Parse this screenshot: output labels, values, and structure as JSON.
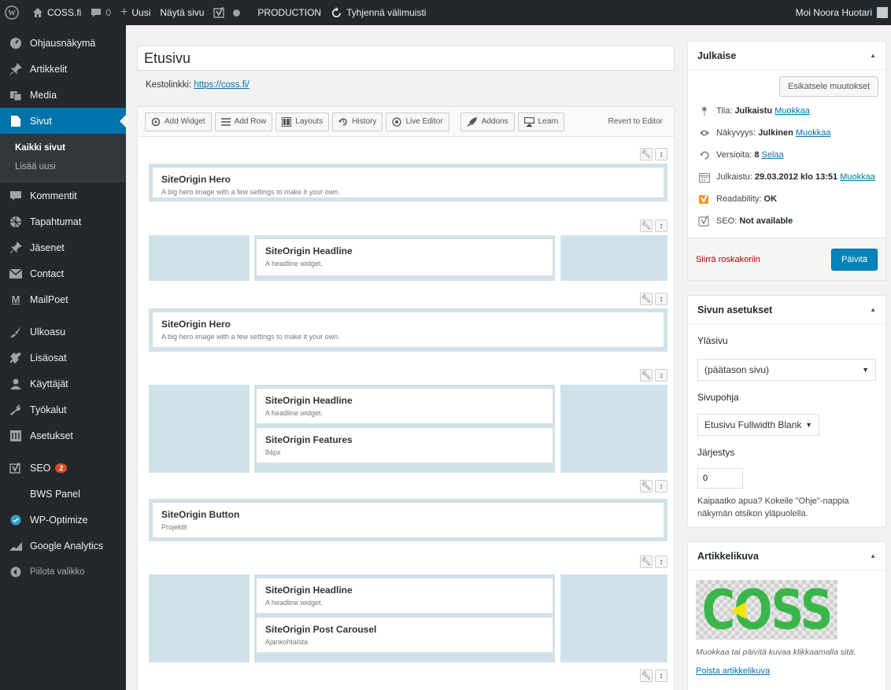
{
  "adminbar": {
    "site_name": "COSS.fi",
    "comments_count": "0",
    "new_label": "Uusi",
    "view_label": "Näytä sivu",
    "env_label": "PRODUCTION",
    "cache_label": "Tyhjennä välimuisti",
    "greeting": "Moi Noora Huotari"
  },
  "sidebar": {
    "items": [
      {
        "label": "Ohjausnäkymä",
        "icon": "dashboard-icon"
      },
      {
        "label": "Artikkelit",
        "icon": "pin-icon"
      },
      {
        "label": "Media",
        "icon": "media-icon"
      },
      {
        "label": "Sivut",
        "icon": "page-icon"
      },
      {
        "label": "Kommentit",
        "icon": "comment-icon"
      },
      {
        "label": "Tapahtumat",
        "icon": "events-icon"
      },
      {
        "label": "Jäsenet",
        "icon": "pin-icon"
      },
      {
        "label": "Contact",
        "icon": "mail-icon"
      },
      {
        "label": "MailPoet",
        "icon": "mailpoet-icon"
      },
      {
        "label": "Ulkoasu",
        "icon": "brush-icon"
      },
      {
        "label": "Lisäosat",
        "icon": "plugin-icon"
      },
      {
        "label": "Käyttäjät",
        "icon": "users-icon"
      },
      {
        "label": "Työkalut",
        "icon": "wrench-icon"
      },
      {
        "label": "Asetukset",
        "icon": "settings-icon"
      },
      {
        "label": "SEO",
        "icon": "yoast-icon",
        "badge": "2"
      },
      {
        "label": "BWS Panel"
      },
      {
        "label": "WP-Optimize",
        "icon": "optimize-icon"
      },
      {
        "label": "Google Analytics",
        "icon": "analytics-icon"
      },
      {
        "label": "Piilota valikko",
        "icon": "collapse-icon"
      }
    ],
    "submenu": [
      "Kaikki sivut",
      "Lisää uusi"
    ]
  },
  "editor": {
    "title": "Etusivu",
    "permalink_label": "Kestolinkki:",
    "permalink_url": "https://coss.fi/"
  },
  "toolbar": {
    "add_widget": "Add Widget",
    "add_row": "Add Row",
    "layouts": "Layouts",
    "history": "History",
    "live_editor": "Live Editor",
    "addons": "Addons",
    "learn": "Learn",
    "revert": "Revert to Editor"
  },
  "widgets": {
    "w1": {
      "title": "SiteOrigin Hero",
      "desc": "A big hero image with a few settings to make it your own."
    },
    "w2": {
      "title": "SiteOrigin Headline",
      "desc": "A headline widget."
    },
    "w3": {
      "title": "SiteOrigin Hero",
      "desc": "A big hero image with a few settings to make it your own."
    },
    "w4": {
      "title": "SiteOrigin Headline",
      "desc": "A headline widget."
    },
    "w5": {
      "title": "SiteOrigin Features",
      "desc": "84px"
    },
    "w6": {
      "title": "SiteOrigin Button",
      "desc": "Projektit"
    },
    "w7": {
      "title": "SiteOrigin Headline",
      "desc": "A headline widget."
    },
    "w8": {
      "title": "SiteOrigin Post Carousel",
      "desc": "Ajankohtaista"
    }
  },
  "publish": {
    "title": "Julkaise",
    "preview_button": "Esikatsele muutokset",
    "status_label": "Tila:",
    "status_value": "Julkaistu",
    "visibility_label": "Näkyvyys:",
    "visibility_value": "Julkinen",
    "revisions_label": "Versioita:",
    "revisions_value": "8",
    "revisions_link": "Selaa",
    "published_label": "Julkaistu:",
    "published_value": "29.03.2012 klo 13:51",
    "edit_link": "Muokkaa",
    "readability_label": "Readability:",
    "readability_value": "OK",
    "seo_label": "SEO:",
    "seo_value": "Not available",
    "trash_link": "Siirrä roskakoriin",
    "update_button": "Päivitä"
  },
  "page_attributes": {
    "title": "Sivun asetukset",
    "parent_label": "Yläsivu",
    "parent_value": "(päätason sivu)",
    "template_label": "Sivupohja",
    "template_value": "Etusivu Fullwidth Blank",
    "order_label": "Järjestys",
    "order_value": "0",
    "help_text": "Kaipaatko apua? Kokeile \"Ohje\"-nappia näkymän otsikon yläpuolella."
  },
  "featured_image": {
    "title": "Artikkelikuva",
    "logo_text": "COSS",
    "hint": "Muokkaa tai päivitä kuvaa klikkaamalla sitä.",
    "remove_link": "Poista artikkelikuva"
  },
  "colors": {
    "adminbar": "#23282d",
    "accent": "#0073aa",
    "primary_button": "#0085ba",
    "logo_green": "#3ab54a",
    "logo_yellow": "#f2e600",
    "row_bg": "#cfe2ec",
    "trash": "#a00"
  }
}
